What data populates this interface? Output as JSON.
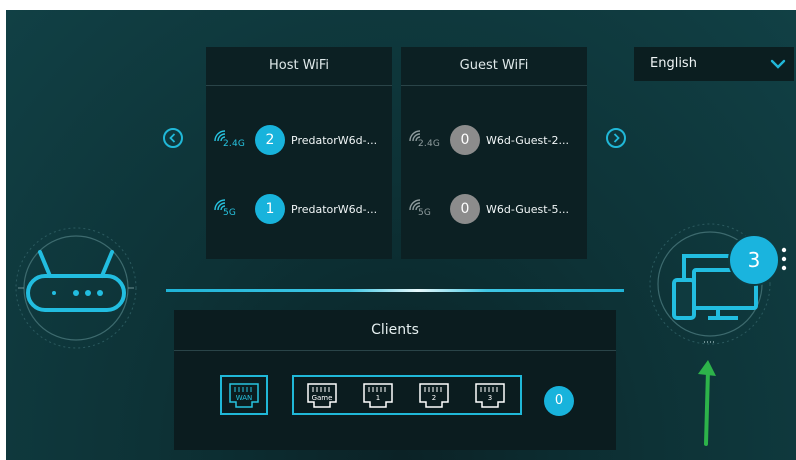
{
  "language": {
    "selected": "English"
  },
  "host_wifi": {
    "title": "Host WiFi",
    "networks": [
      {
        "band": "2.4G",
        "count": "2",
        "ssid": "PredatorW6d-..."
      },
      {
        "band": "5G",
        "count": "1",
        "ssid": "PredatorW6d-..."
      }
    ]
  },
  "guest_wifi": {
    "title": "Guest WiFi",
    "networks": [
      {
        "band": "2.4G",
        "count": "0",
        "ssid": "W6d-Guest-2..."
      },
      {
        "band": "5G",
        "count": "0",
        "ssid": "W6d-Guest-5..."
      }
    ]
  },
  "clients": {
    "title": "Clients",
    "wan_label": "WAN",
    "ports": [
      "Game",
      "1",
      "2",
      "3"
    ],
    "count": "0"
  },
  "devices": {
    "connected_count": "3"
  },
  "colors": {
    "accent": "#18b3dc",
    "inactive": "#8c8c8c",
    "annotation": "#2db34a"
  },
  "icons": [
    "chevron-left-icon",
    "chevron-right-icon",
    "chevron-down-icon",
    "wifi-icon",
    "router-icon",
    "devices-icon",
    "ethernet-port-icon",
    "kebab-menu-icon"
  ]
}
